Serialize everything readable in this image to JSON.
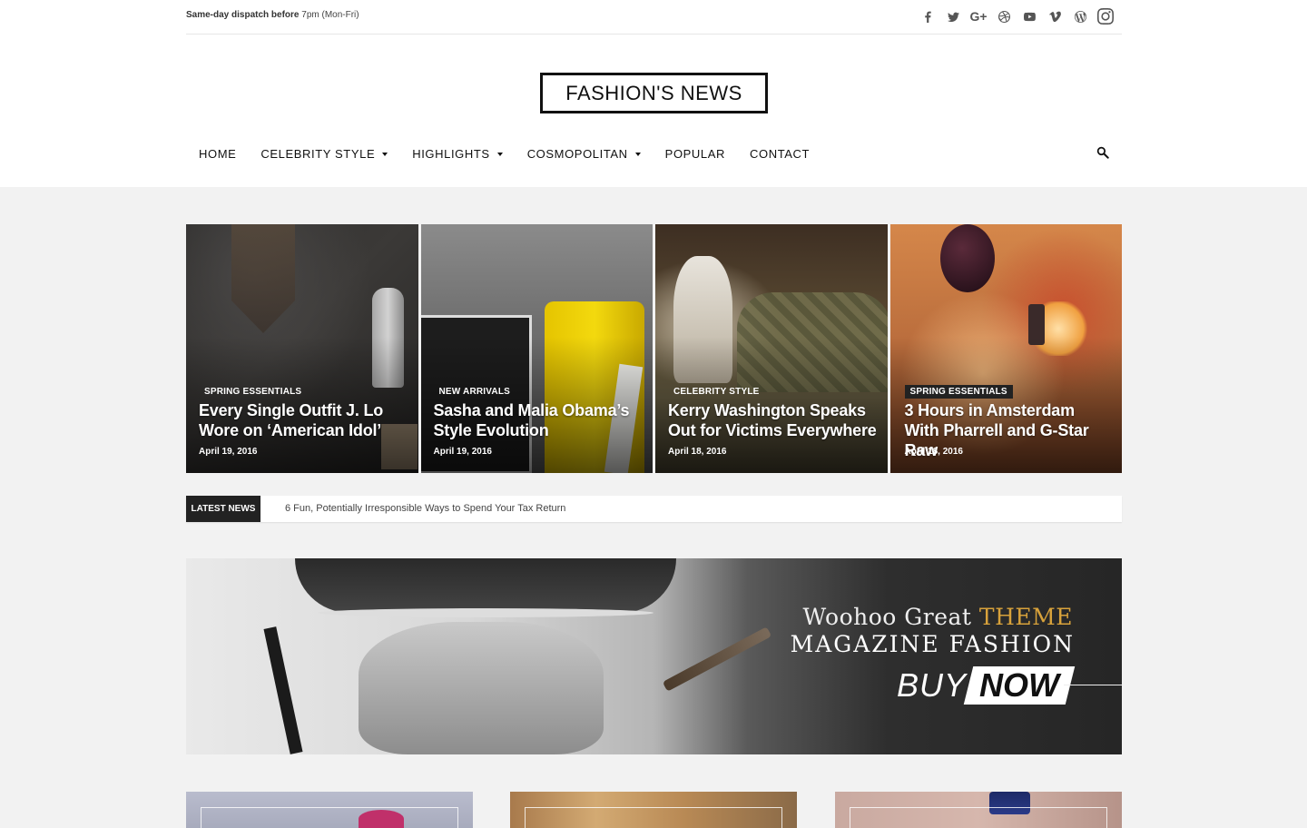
{
  "topbar": {
    "notice_bold": "Same-day dispatch before",
    "notice_rest": " 7pm (Mon-Fri)",
    "socials": [
      "facebook-icon",
      "twitter-icon",
      "google-plus-icon",
      "dribbble-icon",
      "youtube-icon",
      "vimeo-icon",
      "wordpress-icon",
      "instagram-icon"
    ]
  },
  "logo": {
    "text": "FASHION'S NEWS"
  },
  "nav": {
    "items": [
      {
        "label": "HOME",
        "dropdown": false
      },
      {
        "label": "CELEBRITY STYLE",
        "dropdown": true
      },
      {
        "label": "HIGHLIGHTS",
        "dropdown": true
      },
      {
        "label": "COSMOPOLITAN",
        "dropdown": true
      },
      {
        "label": "POPULAR",
        "dropdown": false
      },
      {
        "label": "CONTACT",
        "dropdown": false
      }
    ]
  },
  "featured": [
    {
      "category": "SPRING ESSENTIALS",
      "title": "Every Single Outfit J. Lo Wore on ‘American Idol’",
      "date": "April 19, 2016"
    },
    {
      "category": "NEW ARRIVALS",
      "title": "Sasha and Malia Obama’s Style Evolution",
      "date": "April 19, 2016"
    },
    {
      "category": "CELEBRITY STYLE",
      "title": "Kerry Washington Speaks Out for Victims Everywhere",
      "date": "April 18, 2016"
    },
    {
      "category": "SPRING ESSENTIALS",
      "title": "3 Hours in Amsterdam With Pharrell and G-Star Raw",
      "date": "April 18, 2016"
    }
  ],
  "ticker": {
    "label": "LATEST NEWS",
    "text": "6 Fun, Potentially Irresponsible Ways to Spend Your Tax Return"
  },
  "banner": {
    "line1": "Woohoo Great",
    "line1_highlight": "THEME",
    "line2": "MAGAZINE FASHION",
    "buy": "BUY",
    "now": "NOW"
  },
  "colors": {
    "accent_gold": "#d8a23b",
    "dark_label": "#222222"
  }
}
